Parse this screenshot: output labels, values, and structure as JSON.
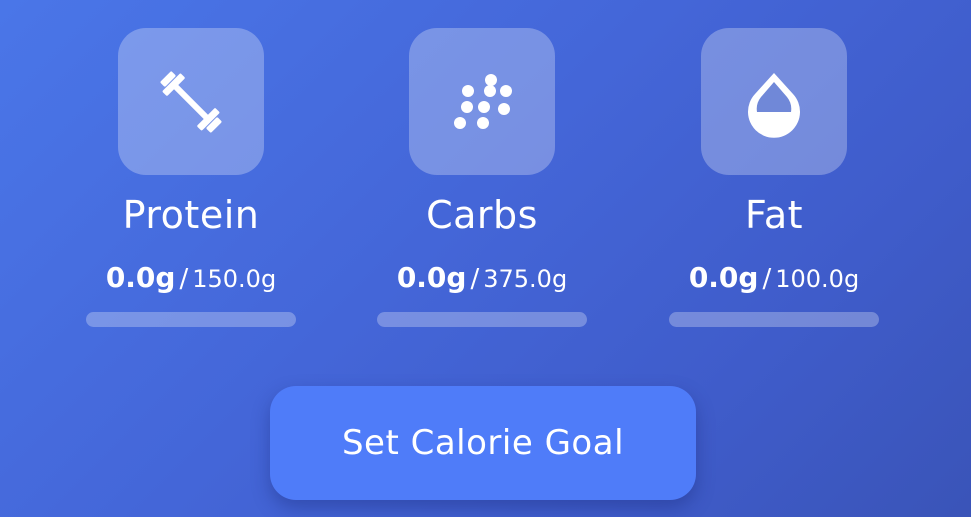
{
  "macros": [
    {
      "name": "Protein",
      "current": "0.0g",
      "goal": "150.0g",
      "progress": 0.0,
      "icon": "dumbbell-icon"
    },
    {
      "name": "Carbs",
      "current": "0.0g",
      "goal": "375.0g",
      "progress": 0.0,
      "icon": "grain-dots-icon"
    },
    {
      "name": "Fat",
      "current": "0.0g",
      "goal": "100.0g",
      "progress": 0.0,
      "icon": "water-drop-icon"
    }
  ],
  "separator": "/",
  "button": {
    "label": "Set Calorie Goal"
  },
  "colors": {
    "background": "#4466d8",
    "button": "#4f7cf9",
    "text": "#ffffff"
  }
}
